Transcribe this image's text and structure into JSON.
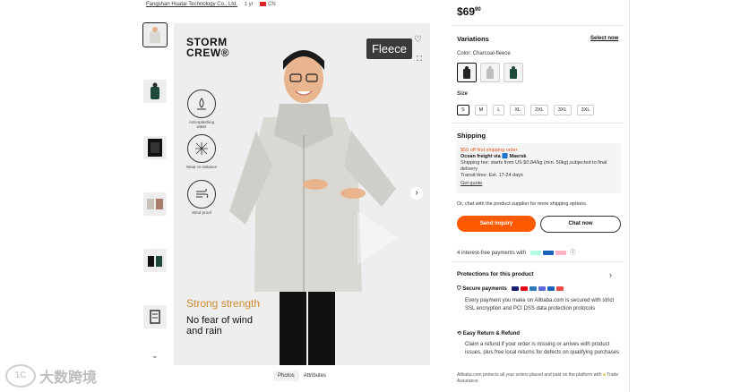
{
  "header": {
    "supplier_text": "Fangshan Huatai Technology Co., Ltd.",
    "supplier_years": "1 yr",
    "supplier_country": "CN"
  },
  "gallery": {
    "thumb_count": 6,
    "brand": "STORM\nCREW®",
    "fleece_tag": "Fleece",
    "features": [
      {
        "label": "Anti-splashing water",
        "icon": "water-drop-icon"
      },
      {
        "label": "Wear re-sistance",
        "icon": "mesh-icon"
      },
      {
        "label": "Wind proof",
        "icon": "wind-icon"
      }
    ],
    "headline": "Strong strength",
    "subline": "No fear of wind and rain",
    "tabs": [
      "Photos",
      "Attributes"
    ],
    "colors": {
      "accent_text": "#cc8a2e",
      "jacket": "#d9d8d3",
      "skin": "#e9b58e"
    }
  },
  "price": {
    "main": "$69",
    "cents": "90"
  },
  "variations": {
    "title": "Variations",
    "select_now": "Select now",
    "color_label": "Color: Charcoal-fleece",
    "sizes_title": "Size",
    "sizes": [
      "S",
      "M",
      "L",
      "XL",
      "2XL",
      "3XL",
      "3XL"
    ]
  },
  "shipping": {
    "title": "Shipping",
    "promo": "$50 off first shipping order",
    "method": "Ocean freight via 🟦 Maersk",
    "fee": "Shipping fee: starts from US $0.84/kg (min. 50kg),subjected to final delivery",
    "transit": "Transit time: Est. 17-24 days",
    "get_quote": "Get quote",
    "chat_note": "Or, chat with the product supplier for more shipping options."
  },
  "actions": {
    "send_inquiry": "Send inquiry",
    "chat_now": "Chat now"
  },
  "payments": {
    "text": "4 interest-free payments with",
    "logos": [
      "Afterpay",
      "PayPal",
      "Klarna"
    ]
  },
  "protections": {
    "title": "Protections for this product",
    "secure_title": "Secure payments",
    "secure_body": "Every payment you make on Alibaba.com is secured with strict SSL encryption and PCI DSS data protection protocols",
    "return_title": "Easy Return & Refund",
    "return_body": "Claim a refund if your order is missing or arrives with product issues, plus free local returns for defects on qualifying purchases",
    "footer": "Alibaba.com protects all your orders placed and paid on the platform with",
    "footer2": "Trade Assurance"
  },
  "watermark": {
    "text": "大数跨境",
    "logo": "1C"
  }
}
